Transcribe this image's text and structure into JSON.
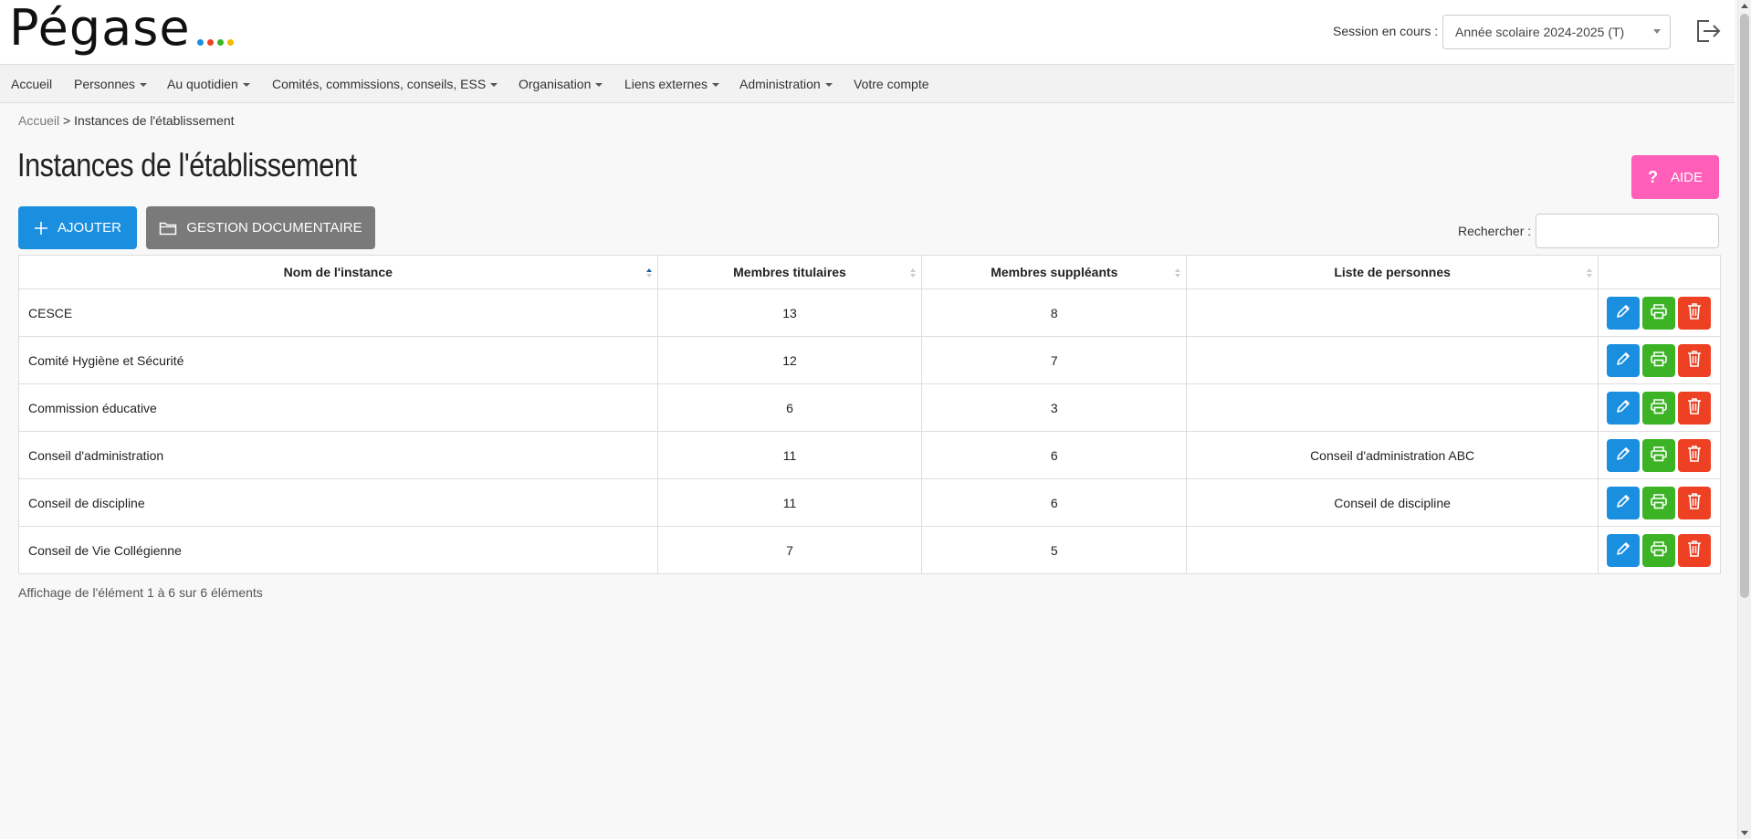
{
  "app": {
    "logo_text": "Pégase",
    "logo_dot_colors": [
      "#1a8fe0",
      "#ee4123",
      "#3bb325",
      "#f5b800"
    ]
  },
  "header": {
    "session_label": "Session en cours :",
    "session_value": "Année scolaire 2024-2025 (T)"
  },
  "nav": {
    "items": [
      {
        "label": "Accueil",
        "dropdown": false
      },
      {
        "label": "Personnes",
        "dropdown": true
      },
      {
        "label": "Au quotidien",
        "dropdown": true
      },
      {
        "label": "Comités, commissions, conseils, ESS",
        "dropdown": true
      },
      {
        "label": "Organisation",
        "dropdown": true
      },
      {
        "label": "Liens externes",
        "dropdown": true
      },
      {
        "label": "Administration",
        "dropdown": true
      },
      {
        "label": "Votre compte",
        "dropdown": false
      }
    ]
  },
  "breadcrumb": {
    "home": "Accueil",
    "separator": ">",
    "current": "Instances de l'établissement"
  },
  "page": {
    "title": "Instances de l'établissement",
    "help_label": "AIDE",
    "help_icon": "?",
    "add_label": "AJOUTER",
    "docs_label": "GESTION DOCUMENTAIRE",
    "search_label": "Rechercher :",
    "search_value": ""
  },
  "table": {
    "columns": [
      "Nom de l'instance",
      "Membres titulaires",
      "Membres suppléants",
      "Liste de personnes"
    ],
    "rows": [
      {
        "name": "CESCE",
        "titulaires": "13",
        "suppleants": "8",
        "liste": ""
      },
      {
        "name": "Comité Hygiène et Sécurité",
        "titulaires": "12",
        "suppleants": "7",
        "liste": ""
      },
      {
        "name": "Commission éducative",
        "titulaires": "6",
        "suppleants": "3",
        "liste": ""
      },
      {
        "name": "Conseil d'administration",
        "titulaires": "11",
        "suppleants": "6",
        "liste": "Conseil d'administration ABC"
      },
      {
        "name": "Conseil de discipline",
        "titulaires": "11",
        "suppleants": "6",
        "liste": "Conseil de discipline"
      },
      {
        "name": "Conseil de Vie Collégienne",
        "titulaires": "7",
        "suppleants": "5",
        "liste": ""
      }
    ],
    "info": "Affichage de l'élément 1 à 6 sur 6 éléments"
  },
  "colors": {
    "primary": "#1a8fe0",
    "help": "#ff5fb8",
    "print": "#3bb325",
    "delete": "#ee4123",
    "docs": "#7a7a7a"
  }
}
